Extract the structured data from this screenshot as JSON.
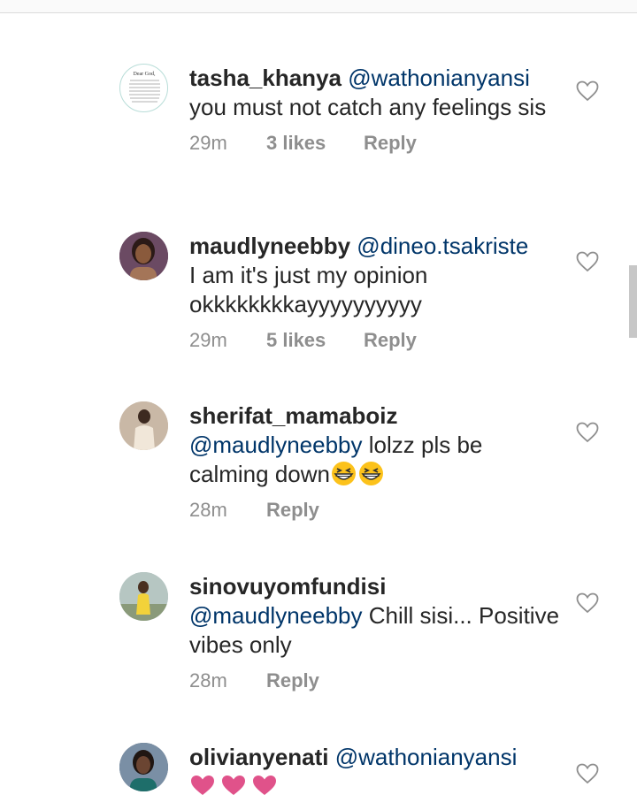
{
  "comments": [
    {
      "username": "tasha_khanya",
      "mention": "@wathonianyansi",
      "text": "you must not catch any feelings sis",
      "time": "29m",
      "likes": "3 likes",
      "reply": "Reply",
      "avatar_text": "Dear God,"
    },
    {
      "username": "maudlyneebby",
      "mention": "@dineo.tsakriste",
      "text": "I am it's just my opinion okkkkkkkkayyyyyyyyyy",
      "time": "29m",
      "likes": "5 likes",
      "reply": "Reply"
    },
    {
      "username": "sherifat_mamaboiz",
      "mention": "@maudlyneebby",
      "text": "lolzz pls be calming down",
      "time": "28m",
      "likes": "",
      "reply": "Reply"
    },
    {
      "username": "sinovuyomfundisi",
      "mention": "@maudlyneebby",
      "text": "Chill sisi... Positive vibes only",
      "time": "28m",
      "likes": "",
      "reply": "Reply"
    },
    {
      "username": "olivianyenati",
      "mention": "@wathonianyansi",
      "text": "",
      "time": "",
      "likes": "",
      "reply": ""
    }
  ],
  "colors": {
    "username": "#262626",
    "mention": "#003569",
    "meta": "#8e8e8e",
    "heart_outline": "#8e8e8e",
    "pink_heart": "#e0528a"
  },
  "icons": [
    "heart-outline-icon",
    "grinning-squinting-face-emoji",
    "pink-heart-emoji"
  ]
}
